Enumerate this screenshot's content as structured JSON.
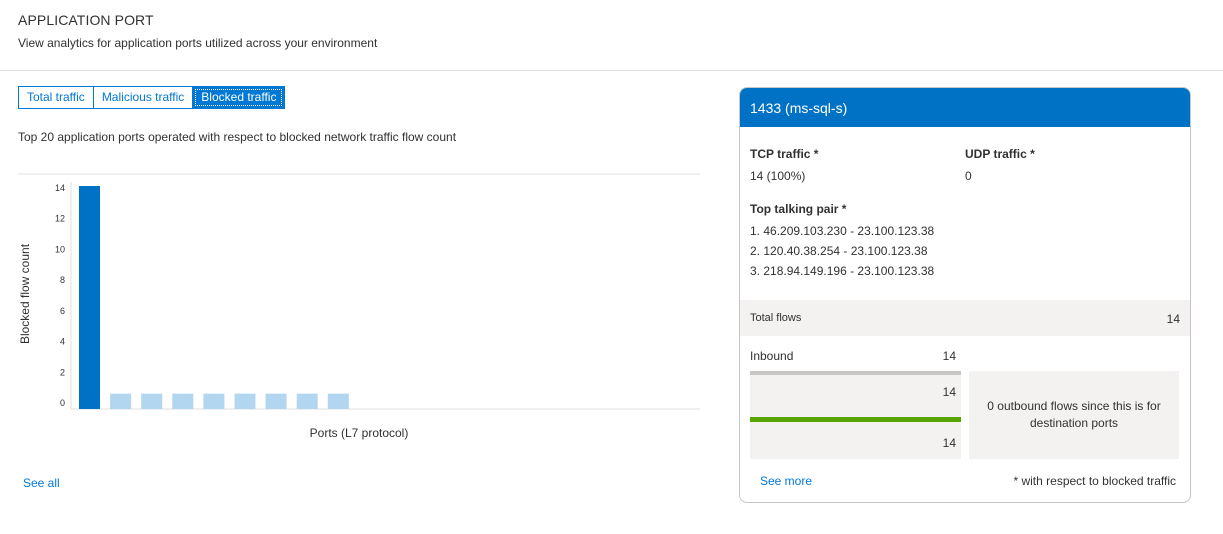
{
  "header": {
    "title": "APPLICATION PORT",
    "subtitle": "View analytics for application ports utilized across your environment"
  },
  "tabs": [
    {
      "label": "Total traffic",
      "active": false
    },
    {
      "label": "Malicious traffic",
      "active": false
    },
    {
      "label": "Blocked traffic",
      "active": true
    }
  ],
  "chart_description": "Top 20 application ports operated with respect to blocked network traffic flow count",
  "chart_data": {
    "type": "bar",
    "xlabel": "Ports (L7 protocol)",
    "ylabel": "Blocked flow count",
    "ylim": [
      0,
      14
    ],
    "yticks": [
      0,
      2,
      4,
      6,
      8,
      10,
      12,
      14
    ],
    "values": [
      14,
      1,
      1,
      1,
      1,
      1,
      1,
      1,
      1
    ],
    "highlighted_index": 0,
    "colors": {
      "highlight": "#0072c6",
      "normal": "#b3d6f0"
    },
    "grid": false
  },
  "see_all": "See all",
  "panel": {
    "title": "1433 (ms-sql-s)",
    "tcp_label": "TCP traffic *",
    "tcp_value": "14 (100%)",
    "udp_label": "UDP traffic *",
    "udp_value": "0",
    "pair_label": "Top talking pair *",
    "pairs": [
      "1. 46.209.103.230 - 23.100.123.38",
      "2. 120.40.38.254 - 23.100.123.38",
      "3. 218.94.149.196 - 23.100.123.38"
    ],
    "total_flows_label": "Total flows",
    "total_flows_value": "14",
    "inbound_label": "Inbound",
    "inbound_value": "14",
    "inbound_upper": "14",
    "inbound_lower": "14",
    "outbound_message": "0 outbound flows since this is for destination ports",
    "see_more": "See more",
    "footnote": "* with respect to blocked traffic"
  }
}
